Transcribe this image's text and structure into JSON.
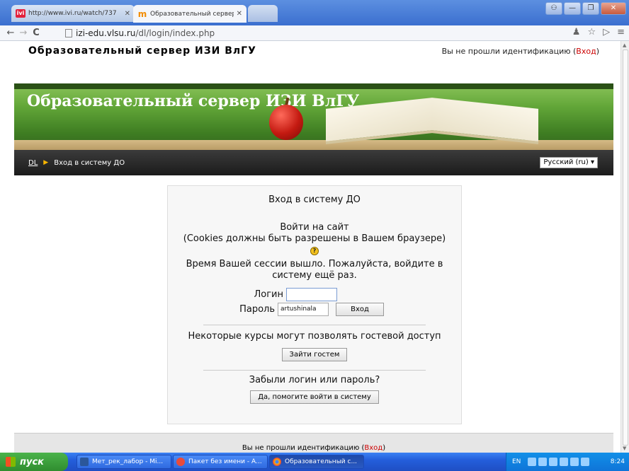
{
  "browser": {
    "tabs": [
      {
        "title": "http://www.ivi.ru/watch/737",
        "favicon": "ivi"
      },
      {
        "title": "Образовательный сервер И",
        "favicon": "m-logo"
      }
    ],
    "address": {
      "host": "izi-edu.vlsu.ru",
      "path": "/dl/login/index.php"
    }
  },
  "site": {
    "title": "Образовательный сервер ИЗИ ВлГУ",
    "login_status_prefix": "Вы не прошли идентификацию (",
    "login_link": "Вход",
    "login_status_suffix": ")",
    "banner_title": "Образовательный сервер ИЗИ ВлГУ"
  },
  "breadcrumb": {
    "home": "DL",
    "current": "Вход в систему ДО"
  },
  "language_select": {
    "selected": "Русский (ru) ▾"
  },
  "loginbox": {
    "heading": "Вход в систему ДО",
    "subtitle_line1": "Войти на сайт",
    "subtitle_line2": "(Cookies должны быть разрешены в Вашем браузере)",
    "help_glyph": "?",
    "session_expired": "Время Вашей сессии вышло. Пожалуйста, войдите в систему ещё раз.",
    "username_label": "Логин",
    "username_value": "",
    "password_label": "Пароль",
    "password_value": "artushinala",
    "login_button": "Вход",
    "guest_text": "Некоторые курсы могут позволять гостевой доступ",
    "guest_button": "Зайти гостем",
    "forgot_text": "Забыли логин или пароль?",
    "forgot_button": "Да, помогите войти в систему"
  },
  "footer": {
    "prefix": "Вы не прошли идентификацию (",
    "link": "Вход",
    "suffix": ")"
  },
  "taskbar": {
    "start_label": "пуск",
    "tasks": [
      {
        "label": "Мет_рек_лабор - Mi...",
        "icon": "word-icon"
      },
      {
        "label": "Пакет без имени - А...",
        "icon": "app-icon"
      },
      {
        "label": "Образовательный с...",
        "icon": "chrome-icon"
      }
    ],
    "tray_lang": "EN",
    "clock": "8:24"
  }
}
